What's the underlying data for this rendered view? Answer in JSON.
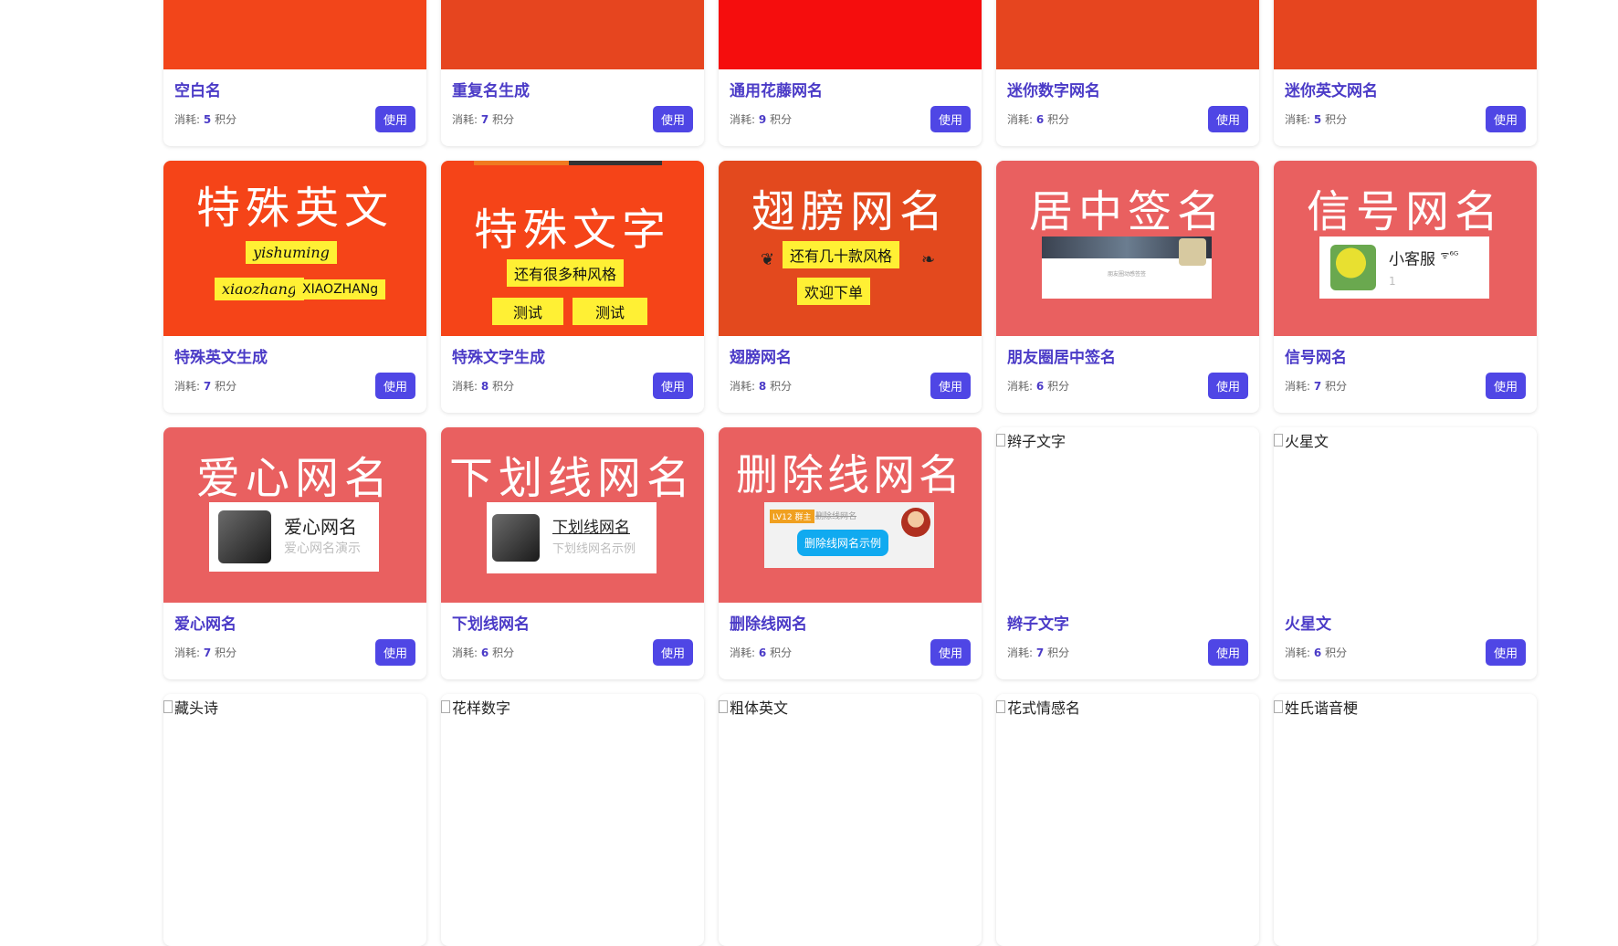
{
  "labels": {
    "cost_prefix": "消耗:",
    "cost_unit": "积分",
    "use_button": "使用"
  },
  "cards": [
    {
      "name": "空白名",
      "cost": "5",
      "bg": "#f2451a"
    },
    {
      "name": "重复名生成",
      "cost": "7",
      "bg": "#e6451f"
    },
    {
      "name": "通用花藤网名",
      "cost": "9",
      "bg": "#f50d0d"
    },
    {
      "name": "迷你数字网名",
      "cost": "6",
      "bg": "#e6451f"
    },
    {
      "name": "迷你英文网名",
      "cost": "5",
      "bg": "#e6451f"
    },
    {
      "name": "特殊英文生成",
      "cost": "7",
      "bg": "#f54418",
      "thumb_title": "特殊英文",
      "stickers": [
        "yishuming",
        "xiaozhang",
        "XIAOZHANg"
      ]
    },
    {
      "name": "特殊文字生成",
      "cost": "8",
      "bg": "#f54418",
      "thumb_title": "特殊文字",
      "stickers": [
        "还有很多种风格",
        "测试",
        "测试"
      ]
    },
    {
      "name": "翅膀网名",
      "cost": "8",
      "bg": "#e3491e",
      "thumb_title": "翅膀网名",
      "stickers": [
        "还有几十款风格",
        "欢迎下单"
      ]
    },
    {
      "name": "朋友圈居中签名",
      "cost": "6",
      "bg": "#e96060",
      "thumb_title": "居中签名",
      "panel_caption": "朋友圈动感签签"
    },
    {
      "name": "信号网名",
      "cost": "7",
      "bg": "#e96060",
      "thumb_title": "信号网名",
      "panel_main": "小客服",
      "panel_signal": "ᯤ⁶ᴳ",
      "panel_sub": "1"
    },
    {
      "name": "爱心网名",
      "cost": "7",
      "bg": "#e96060",
      "thumb_title": "爱心网名",
      "panel_main": "爱心网名",
      "panel_sub": "爱心网名演示"
    },
    {
      "name": "下划线网名",
      "cost": "6",
      "bg": "#e96060",
      "thumb_title": "下划线网名",
      "panel_main": "下划线网名",
      "panel_sub": "下划线网名示例"
    },
    {
      "name": "删除线网名",
      "cost": "6",
      "bg": "#e96060",
      "thumb_title": "删除线网名",
      "panel_tag": "LV12 群主",
      "panel_text": "删除线网名",
      "panel_bubble": "删除线网名示例"
    },
    {
      "name": "辫子文字",
      "cost": "7",
      "alt": "辫子文字"
    },
    {
      "name": "火星文",
      "cost": "6",
      "alt": "火星文"
    },
    {
      "alt": "藏头诗"
    },
    {
      "alt": "花样数字"
    },
    {
      "alt": "粗体英文"
    },
    {
      "alt": "花式情感名"
    },
    {
      "alt": "姓氏谐音梗"
    }
  ]
}
